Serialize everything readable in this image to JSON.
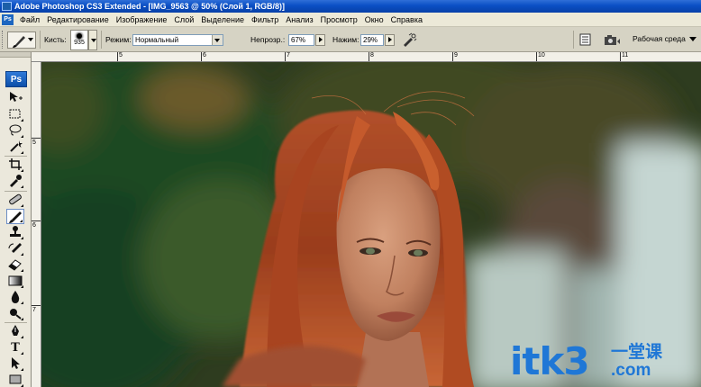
{
  "window": {
    "title": "Adobe Photoshop CS3 Extended - [IMG_9563 @ 50% (Слой 1, RGB/8)]",
    "app_icon": "photoshop-icon",
    "menu_logo": "Ps"
  },
  "menu": {
    "items": [
      "Файл",
      "Редактирование",
      "Изображение",
      "Слой",
      "Выделение",
      "Фильтр",
      "Анализ",
      "Просмотр",
      "Окно",
      "Справка"
    ]
  },
  "options": {
    "brush_label": "Кисть:",
    "brush_size": "935",
    "mode_label": "Режим:",
    "mode_value": "Нормальный",
    "opacity_label": "Непрозр.:",
    "opacity_value": "67%",
    "flow_label": "Нажим:",
    "flow_value": "29%",
    "workspace_label": "Рабочая среда"
  },
  "toolbox": {
    "logo": "Ps",
    "tools": [
      "move-icon",
      "marquee-icon",
      "lasso-icon",
      "magic-wand-icon",
      "crop-icon",
      "eyedropper-icon",
      "healing-icon",
      "brush-icon",
      "clone-stamp-icon",
      "history-brush-icon",
      "eraser-icon",
      "gradient-icon",
      "blur-icon",
      "dodge-icon",
      "pen-icon",
      "type-icon",
      "path-selection-icon",
      "shape-icon"
    ],
    "active_tool": "brush-icon"
  },
  "rulers": {
    "top_labels": [
      "5",
      "6",
      "7",
      "8",
      "9",
      "10",
      "11"
    ],
    "left_labels": [
      "5",
      "6",
      "7"
    ]
  },
  "watermark": {
    "main": "itk3",
    "cn": "一堂课",
    "com": ".com"
  },
  "colors": {
    "titlebar": "#0a4fc4",
    "chrome": "#ece9d8",
    "watermark": "#1f77d6"
  }
}
